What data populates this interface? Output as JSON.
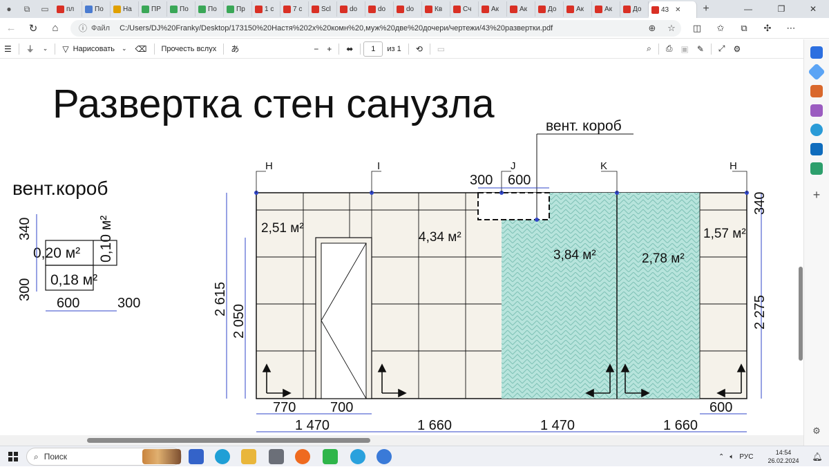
{
  "browser": {
    "tabs": [
      {
        "label": "пл",
        "color": "#d93025"
      },
      {
        "label": "По",
        "color": "#4a7bd0"
      },
      {
        "label": "На",
        "color": "#e0a000"
      },
      {
        "label": "ПР",
        "color": "#3aa757"
      },
      {
        "label": "По",
        "color": "#3aa757"
      },
      {
        "label": "По",
        "color": "#3aa757"
      },
      {
        "label": "Пр",
        "color": "#3aa757"
      },
      {
        "label": "1 с",
        "color": "#d93025"
      },
      {
        "label": "7 с",
        "color": "#d93025"
      },
      {
        "label": "Scl",
        "color": "#d93025"
      },
      {
        "label": "do",
        "color": "#d93025"
      },
      {
        "label": "do",
        "color": "#d93025"
      },
      {
        "label": "do",
        "color": "#d93025"
      },
      {
        "label": "Кв",
        "color": "#d93025"
      },
      {
        "label": "Сч",
        "color": "#d93025"
      },
      {
        "label": "Ак",
        "color": "#d93025"
      },
      {
        "label": "Ак",
        "color": "#d93025"
      },
      {
        "label": "До",
        "color": "#d93025"
      },
      {
        "label": "Ак",
        "color": "#d93025"
      },
      {
        "label": "Ак",
        "color": "#d93025"
      },
      {
        "label": "До",
        "color": "#d93025"
      }
    ],
    "active_tab": {
      "label": "43",
      "color": "#d93025"
    },
    "address": {
      "scheme_label": "Файл",
      "url": "C:/Users/DJ%20Franky/Desktop/173150%20Настя%202х%20комн%20,муж%20две%20дочери/чертежи/43%20развертки.pdf"
    }
  },
  "pdf_toolbar": {
    "draw_label": "Нарисовать",
    "read_aloud_label": "Прочесть вслух",
    "page_current": "1",
    "page_total": "из 1"
  },
  "drawing": {
    "title": "Развертка стен санузла",
    "vent_callout": "вент. короб",
    "vent_detail": {
      "title": "вент.короб",
      "area_a": "0,20 м²",
      "area_b": "0,10 м²",
      "area_c": "0,18 м²",
      "dim_340": "340",
      "dim_300_v": "300",
      "dim_600": "600",
      "dim_300_h": "300"
    },
    "axes": [
      "H",
      "I",
      "J",
      "K",
      "H"
    ],
    "areas": [
      "2,51 м²",
      "4,34 м²",
      "3,84 м²",
      "2,78 м²",
      "1,57 м²"
    ],
    "dims_top": [
      "300",
      "600"
    ],
    "dims_left": [
      "2 615",
      "2 050"
    ],
    "dims_right": [
      "340",
      "2 275"
    ],
    "dims_bottom_row1": [
      "770",
      "700",
      "600"
    ],
    "dims_bottom_row2": [
      "1 470",
      "1 660",
      "1 470",
      "1 660"
    ],
    "colors": {
      "wall": "#f5f2ea",
      "tile_accent": "#b7e4dc",
      "dimension": "#2f45c8"
    }
  },
  "taskbar": {
    "search_placeholder": "Поиск",
    "tray_lang": "РУС",
    "time": "14:54",
    "date": "26.02.2024"
  }
}
